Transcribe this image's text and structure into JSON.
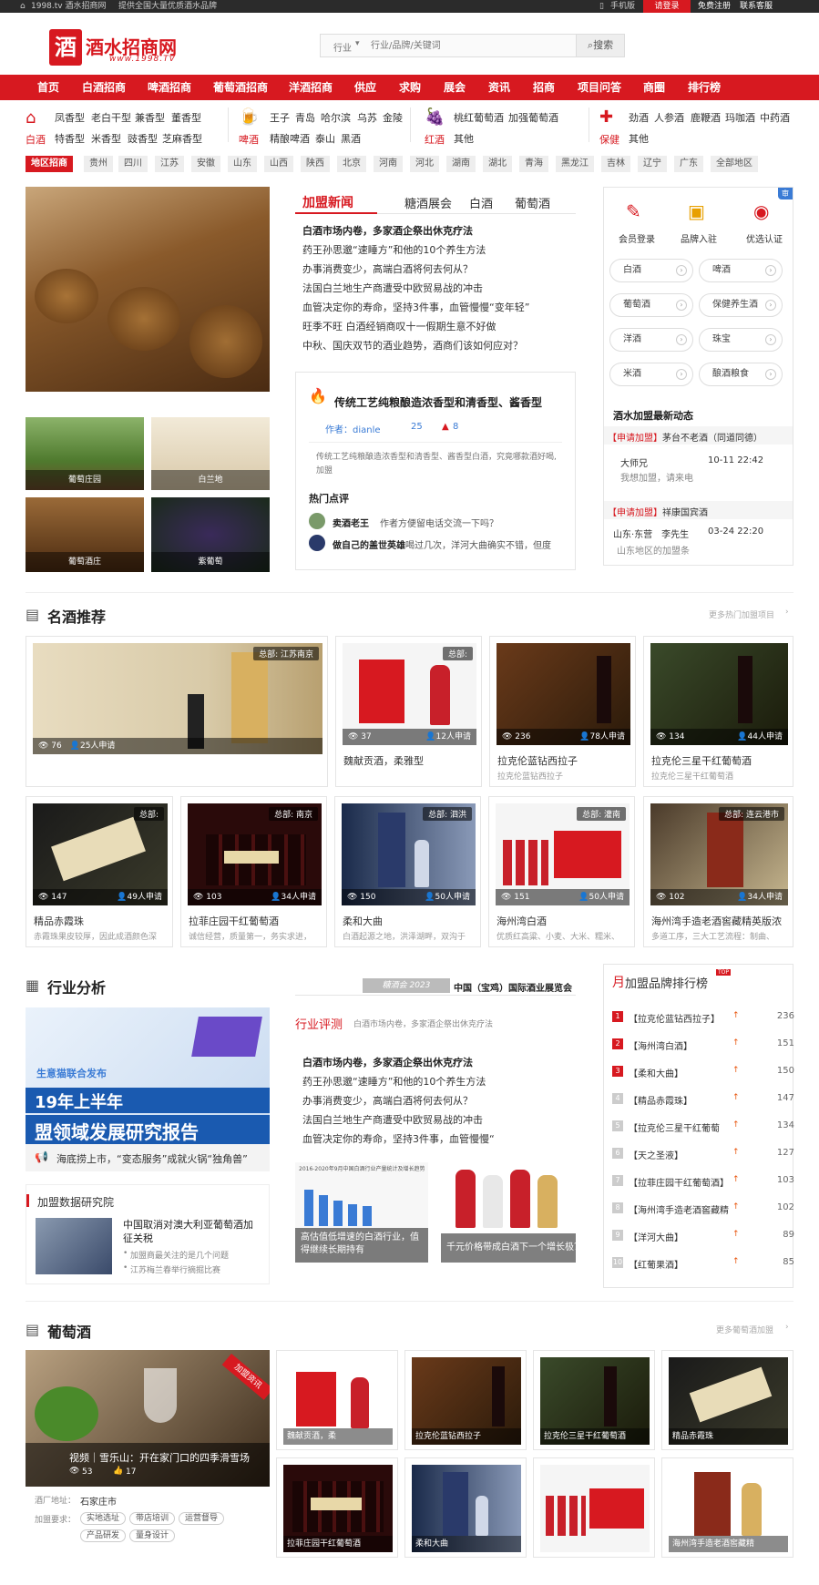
{
  "top": {
    "left1": "1998.tv 酒水招商网",
    "left2": "提供全国大量优质酒水品牌",
    "mobile": "手机版",
    "login": "请登录",
    "register": "免费注册",
    "contact": "联系客服"
  },
  "logo": {
    "text": "酒水招商网",
    "url": "www.1998.TV"
  },
  "search": {
    "scope": "行业",
    "placeholder": "行业/品牌/关键词",
    "button": "搜索"
  },
  "nav": [
    "首页",
    "白酒招商",
    "啤酒招商",
    "葡萄酒招商",
    "洋酒招商",
    "供应",
    "求购",
    "展会",
    "资讯",
    "招商",
    "项目问答",
    "商圈",
    "排行榜"
  ],
  "cats": [
    {
      "label": "白酒",
      "items": [
        "凤香型",
        "老白干型",
        "兼香型",
        "董香型",
        "特香型",
        "米香型",
        "豉香型",
        "芝麻香型"
      ]
    },
    {
      "label": "啤酒",
      "items": [
        "王子",
        "青岛",
        "哈尔滨",
        "乌苏",
        "金陵",
        "精酿啤酒",
        "泰山",
        "黑酒"
      ]
    },
    {
      "label": "红酒",
      "items": [
        "桃红葡萄酒",
        "加强葡萄酒",
        "其他"
      ]
    },
    {
      "label": "保健",
      "items": [
        "劲酒",
        "人参酒",
        "鹿鞭酒",
        "玛咖酒",
        "中药酒",
        "其他"
      ]
    }
  ],
  "region": {
    "label": "地区招商",
    "items": [
      "贵州",
      "四川",
      "江苏",
      "安徽",
      "山东",
      "山西",
      "陕西",
      "北京",
      "河南",
      "河北",
      "湖南",
      "湖北",
      "青海",
      "黑龙江",
      "吉林",
      "辽宁",
      "广东",
      "全部地区"
    ]
  },
  "thumbs": [
    "葡萄庄园",
    "白兰地",
    "葡萄酒庄",
    "紫葡萄"
  ],
  "news": {
    "tabs": [
      "加盟新闻",
      "糖酒展会",
      "白酒",
      "葡萄酒"
    ],
    "items": [
      "白酒市场内卷，多家酒企祭出休克疗法",
      "药王孙思邈“速睡方”和他的10个养生方法",
      "办事消费变少，高端白酒将何去何从？",
      "法国白兰地生产商遭受中欧贸易战的冲击",
      "血管决定你的寿命，坚持3件事，血管慢慢“变年轻”",
      "旺季不旺 白酒经销商叹十一假期生意不好做",
      "中秋、国庆双节的酒业趋势，酒商们该如何应对？"
    ]
  },
  "feature": {
    "title": "传统工艺纯粮酿造浓香型和清香型、酱香型",
    "author": "作者：dianle",
    "views": "25",
    "likes": "8",
    "desc": "传统工艺纯粮酿造浓香型和清香型、酱香型白酒，究竟哪款酒好喝,加盟",
    "hot": "热门点评",
    "c1u": "卖酒老王",
    "c1t": "作者方便留电话交流一下吗？",
    "c2u": "做自己的盖世英雄",
    "c2t": "喝过几次，洋河大曲确实不错，但度"
  },
  "side": {
    "badge": "审",
    "icons": [
      "会员登录",
      "品牌入驻",
      "优选认证"
    ],
    "pills": [
      "白酒",
      "啤酒",
      "葡萄酒",
      "保健养生酒",
      "洋酒",
      "珠宝",
      "米酒",
      "酿酒粮食"
    ],
    "dyn": "酒水加盟最新动态",
    "a1tag": "【申请加盟】",
    "a1": "茅台不老酒（同道同德）",
    "a1u": "大师兄",
    "a1t": "10-11 22:42",
    "a1m": "我想加盟，请来电",
    "a2tag": "【申请加盟】",
    "a2": "祥康国宾酒",
    "a2u": "山东·东营　李先生",
    "a2t": "03-24 22:20",
    "a2m": "山东地区的加盟条"
  },
  "famous": {
    "title": "名酒推荐",
    "more": "更多热门加盟项目",
    "cards": [
      {
        "loc": "总部: 江苏南京",
        "views": "76",
        "apply": "25人申请",
        "title": "",
        "desc": ""
      },
      {
        "loc": "总部:",
        "views": "37",
        "apply": "12人申请",
        "title": "魏献贡酒，柔雅型",
        "desc": ""
      },
      {
        "loc": "",
        "views": "236",
        "apply": "78人申请",
        "title": "拉克伦蓝钻西拉子",
        "desc": "拉克伦蓝钻西拉子"
      },
      {
        "loc": "",
        "views": "134",
        "apply": "44人申请",
        "title": "拉克伦三星干红葡萄酒",
        "desc": "拉克伦三星干红葡萄酒"
      },
      {
        "loc": "总部:",
        "views": "147",
        "apply": "49人申请",
        "title": "精品赤霞珠",
        "desc": "赤霞珠果皮较厚，因此成酒颜色深"
      },
      {
        "loc": "总部: 南京",
        "views": "103",
        "apply": "34人申请",
        "title": "拉菲庄园干红葡萄酒",
        "desc": "诚信经营，质量第一，务实求进，"
      },
      {
        "loc": "总部: 泗洪",
        "views": "150",
        "apply": "50人申请",
        "title": "柔和大曲",
        "desc": "白酒起源之地，洪泽湖畔，双沟于"
      },
      {
        "loc": "总部: 灌南",
        "views": "151",
        "apply": "50人申请",
        "title": "海州湾白酒",
        "desc": "优质红高粱、小麦、大米、糯米、"
      },
      {
        "loc": "总部: 连云港市",
        "views": "102",
        "apply": "34人申请",
        "title": "海州湾手造老酒窖藏精英版浓",
        "desc": "多道工序，三大工艺流程：制曲、"
      }
    ]
  },
  "industry": {
    "title": "行业分析",
    "expo_tag": "糖酒会 2023",
    "expo": "中国（宝鸡）国际酒业展览会",
    "banner1": "生意猫联合发布",
    "banner2": "19年上半年",
    "banner3": "盟领域发展研究报告",
    "hl": "海底捞上市，“变态服务”成就火锅“独角兽”",
    "rev_label": "行业评测",
    "rev_sub": "白酒市场内卷，多家酒企祭出休克疗法",
    "items": [
      "白酒市场内卷，多家酒企祭出休克疗法",
      "药王孙思邈“速睡方”和他的10个养生方法",
      "办事消费变少，高端白酒将何去何从？",
      "法国白兰地生产商遭受中欧贸易战的冲击",
      "血管决定你的寿命，坚持3件事，血管慢慢“"
    ],
    "chart_cap": "高估值低增速的白酒行业，值得继续长期持有",
    "chart_hdr": "2016-2020年9月中国白酒行业产量统计及增长趋势",
    "bottles_cap": "千元价格带成白酒下一个增长极？",
    "research": "加盟数据研究院",
    "r_title": "中国取消对澳大利亚葡萄酒加征关税",
    "r1": "加盟商最关注的是几个问题",
    "r2": "江苏梅兰春举行摘掘比赛"
  },
  "ranking": {
    "month": "月",
    "title": "加盟品牌排行榜",
    "hot": "TOP",
    "rows": [
      {
        "n": "1",
        "name": "【拉克伦蓝钻西拉子】",
        "v": "236"
      },
      {
        "n": "2",
        "name": "【海州湾白酒】",
        "v": "151"
      },
      {
        "n": "3",
        "name": "【柔和大曲】",
        "v": "150"
      },
      {
        "n": "4",
        "name": "【精品赤霞珠】",
        "v": "147"
      },
      {
        "n": "5",
        "name": "【拉克伦三星干红葡萄",
        "v": "134"
      },
      {
        "n": "6",
        "name": "【天之圣液】",
        "v": "127"
      },
      {
        "n": "7",
        "name": "【拉菲庄园干红葡萄酒】",
        "v": "103"
      },
      {
        "n": "8",
        "name": "【海州湾手造老酒窖藏精",
        "v": "102"
      },
      {
        "n": "9",
        "name": "【洋河大曲】",
        "v": "89"
      },
      {
        "n": "10",
        "name": "【红葡果酒】",
        "v": "85"
      }
    ]
  },
  "grape": {
    "title": "葡萄酒",
    "more": "更多葡萄酒加盟",
    "feat_tag": "加盟资讯",
    "feat": "视频｜雪乐山：开在家门口的四季滑雪场",
    "feat_views": "53",
    "feat_likes": "17",
    "addr_l": "酒厂地址：",
    "addr": "石家庄市",
    "req_l": "加盟要求：",
    "tags": [
      "实地选址",
      "带店培训",
      "运营督导",
      "产品研发",
      "量身设计"
    ],
    "items": [
      "魏献贡酒，柔",
      "拉克伦蓝钻西拉子",
      "拉克伦三星干红葡萄酒",
      "精品赤霞珠",
      "拉菲庄园干红葡萄酒",
      "柔和大曲",
      "",
      "海州湾手造老酒窖藏精"
    ]
  },
  "colors": {
    "brand": "#d71920",
    "dark": "#2b2b2b"
  }
}
